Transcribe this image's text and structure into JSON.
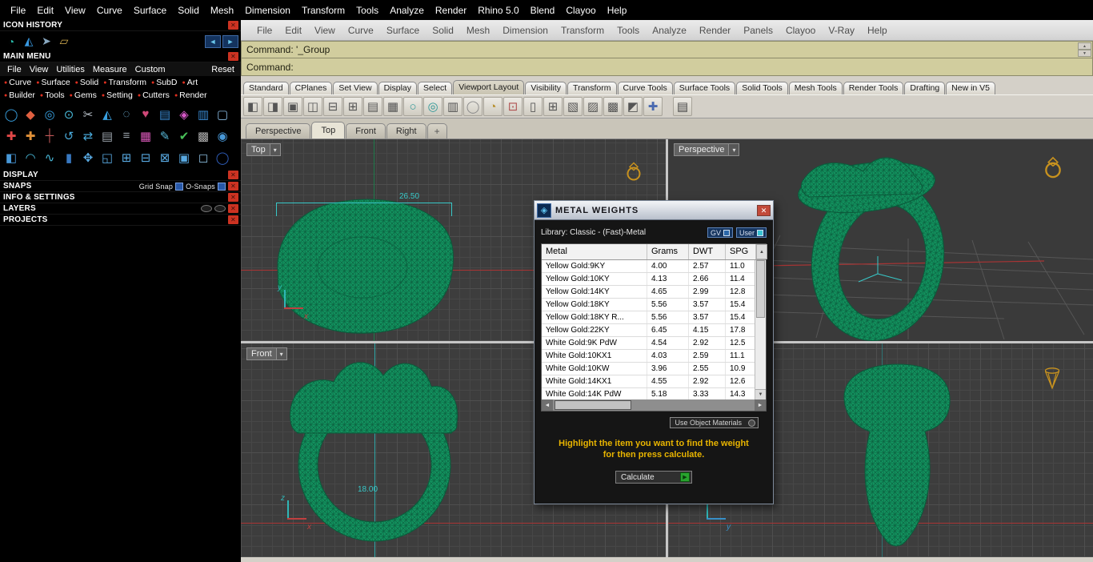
{
  "icons": {
    "close": "✕",
    "dropdown": "▾",
    "up": "▲",
    "down": "▼",
    "left": "◄",
    "right": "►",
    "play": "▶",
    "plus_tab": "+",
    "bullet": "●"
  },
  "colors": {
    "viewport_green": "#12925e",
    "dimension_teal": "#38c8c8",
    "axis_red": "#a83434",
    "gold": "#c8921e"
  },
  "top_menubar": {
    "items": [
      "File",
      "Edit",
      "View",
      "Curve",
      "Surface",
      "Solid",
      "Mesh",
      "Dimension",
      "Transform",
      "Tools",
      "Analyze",
      "Render",
      "Rhino 5.0",
      "Blend",
      "Clayoo",
      "Help"
    ]
  },
  "menubar2": {
    "items": [
      "File",
      "Edit",
      "View",
      "Curve",
      "Surface",
      "Solid",
      "Mesh",
      "Dimension",
      "Transform",
      "Tools",
      "Analyze",
      "Render",
      "Panels",
      "Clayoo",
      "V-Ray",
      "Help"
    ]
  },
  "sidebar": {
    "icon_history": {
      "title": "ICON HISTORY",
      "icons": [
        {
          "g": "◔",
          "c": "#28b8a8"
        },
        {
          "g": "◭",
          "c": "#3898e0"
        },
        {
          "g": "➤",
          "c": "#88a8c0"
        },
        {
          "g": "▱",
          "c": "#d8b050"
        }
      ]
    },
    "main_menu": {
      "title": "MAIN MENU",
      "items": [
        "File",
        "View",
        "Utilities",
        "Measure",
        "Custom"
      ],
      "reset": "Reset",
      "cats1": [
        "Curve",
        "Surface",
        "Solid",
        "Transform",
        "SubD",
        "Art"
      ],
      "cats2": [
        "Builder",
        "Tools",
        "Gems",
        "Setting",
        "Cutters",
        "Render"
      ],
      "icon_rows": [
        [
          {
            "g": "◯",
            "c": "#38a0e0"
          },
          {
            "g": "◆",
            "c": "#e06040"
          },
          {
            "g": "◎",
            "c": "#38a0e0"
          },
          {
            "g": "⊙",
            "c": "#48b8d8"
          },
          {
            "g": "✂",
            "c": "#b8c0c8"
          },
          {
            "g": "◭",
            "c": "#38a0e0"
          },
          {
            "g": "◌",
            "c": "#78c0e8"
          },
          {
            "g": "♥",
            "c": "#d04878"
          },
          {
            "g": "▤",
            "c": "#3888d0"
          },
          {
            "g": "◈",
            "c": "#d858c8"
          },
          {
            "g": "▥",
            "c": "#3888d0"
          },
          {
            "g": "▢",
            "c": "#88b8e0"
          }
        ],
        [
          {
            "g": "✚",
            "c": "#e04848"
          },
          {
            "g": "✚",
            "c": "#e09038"
          },
          {
            "g": "┼",
            "c": "#c05858"
          },
          {
            "g": "↺",
            "c": "#48a8d8"
          },
          {
            "g": "⇄",
            "c": "#48a8d8"
          },
          {
            "g": "▤",
            "c": "#98a0a8"
          },
          {
            "g": "≡",
            "c": "#98a0a8"
          },
          {
            "g": "▦",
            "c": "#d858b8"
          },
          {
            "g": "✎",
            "c": "#58b8d8"
          },
          {
            "g": "✔",
            "c": "#48c058"
          },
          {
            "g": "▩",
            "c": "#b0b0b0"
          },
          {
            "g": "◉",
            "c": "#4898d8"
          }
        ],
        [
          {
            "g": "◧",
            "c": "#4898d8"
          },
          {
            "g": "◠",
            "c": "#48b8d8"
          },
          {
            "g": "∿",
            "c": "#48b8d8"
          },
          {
            "g": "▮",
            "c": "#3878c0"
          },
          {
            "g": "✥",
            "c": "#58a8e0"
          },
          {
            "g": "◱",
            "c": "#58a8e0"
          },
          {
            "g": "⊞",
            "c": "#58a8e0"
          },
          {
            "g": "⊟",
            "c": "#58a8e0"
          },
          {
            "g": "⊠",
            "c": "#58a8e0"
          },
          {
            "g": "▣",
            "c": "#58a8e0"
          },
          {
            "g": "◻",
            "c": "#88b8d8"
          },
          {
            "g": "◯",
            "c": "#3060c0"
          }
        ]
      ]
    },
    "display": {
      "title": "DISPLAY"
    },
    "snaps": {
      "title": "SNAPS",
      "grid_snap": "Grid Snap",
      "osnaps": "O-Snaps"
    },
    "info": {
      "title": "INFO & SETTINGS"
    },
    "layers": {
      "title": "LAYERS"
    },
    "projects": {
      "title": "PROJECTS"
    }
  },
  "command": {
    "history": "Command: '_Group",
    "prompt": "Command:"
  },
  "ribbon_tabs": {
    "items": [
      "Standard",
      "CPlanes",
      "Set View",
      "Display",
      "Select",
      "Viewport Layout",
      "Visibility",
      "Transform",
      "Curve Tools",
      "Surface Tools",
      "Solid Tools",
      "Mesh Tools",
      "Render Tools",
      "Drafting",
      "New in V5"
    ],
    "active": "Viewport Layout"
  },
  "toolbar_icons": [
    {
      "g": "◧"
    },
    {
      "g": "◨"
    },
    {
      "g": "▣"
    },
    {
      "g": "◫"
    },
    {
      "g": "⊟"
    },
    {
      "g": "⊞"
    },
    {
      "g": "▤"
    },
    {
      "g": "▦"
    },
    {
      "g": "○",
      "c": "#2f9898"
    },
    {
      "g": "◎",
      "c": "#2f9898"
    },
    {
      "g": "▥"
    },
    {
      "g": "◯",
      "c": "#888888"
    },
    {
      "g": "◔",
      "c": "#b89030"
    },
    {
      "g": "⊡",
      "c": "#b05050"
    },
    {
      "g": "▯"
    },
    {
      "g": "⊞"
    },
    {
      "g": "▧"
    },
    {
      "g": "▨"
    },
    {
      "g": "▩"
    },
    {
      "g": "◩"
    },
    {
      "g": "✚",
      "c": "#4a6ab0"
    },
    {
      "g": "▤",
      "c": "#444444",
      "sep": true,
      "n": "printer"
    }
  ],
  "viewport_tabs": {
    "items": [
      "Perspective",
      "Top",
      "Front",
      "Right"
    ],
    "active": "Top"
  },
  "viewports": {
    "top": {
      "label": "Top",
      "dimension": "26.50",
      "axis_v": "y",
      "axis_h": "x"
    },
    "perspective": {
      "label": "Perspective"
    },
    "front": {
      "label": "Front",
      "dimension": "18.00",
      "axis_v": "z",
      "axis_h": "x"
    },
    "right": {
      "axis_v": "z",
      "axis_h": "y"
    }
  },
  "dialog": {
    "title": "METAL WEIGHTS",
    "library": "Library: Classic - (Fast)-Metal",
    "gv": "GV",
    "user": "User",
    "table": {
      "headers": [
        "Metal",
        "Grams",
        "DWT",
        "SPG"
      ],
      "rows": [
        [
          "Yellow Gold:9KY",
          "4.00",
          "2.57",
          "11.0"
        ],
        [
          "Yellow Gold:10KY",
          "4.13",
          "2.66",
          "11.4"
        ],
        [
          "Yellow Gold:14KY",
          "4.65",
          "2.99",
          "12.8"
        ],
        [
          "Yellow Gold:18KY",
          "5.56",
          "3.57",
          "15.4"
        ],
        [
          "Yellow Gold:18KY R...",
          "5.56",
          "3.57",
          "15.4"
        ],
        [
          "Yellow Gold:22KY",
          "6.45",
          "4.15",
          "17.8"
        ],
        [
          "White Gold:9K PdW",
          "4.54",
          "2.92",
          "12.5"
        ],
        [
          "White Gold:10KX1",
          "4.03",
          "2.59",
          "11.1"
        ],
        [
          "White Gold:10KW",
          "3.96",
          "2.55",
          "10.9"
        ],
        [
          "White Gold:14KX1",
          "4.55",
          "2.92",
          "12.6"
        ],
        [
          "White Gold:14K PdW",
          "5.18",
          "3.33",
          "14.3"
        ]
      ]
    },
    "materials_select": "Use Object Materials",
    "instruction_line1": "Highlight the item you want to find the weight",
    "instruction_line2": "for then press calculate.",
    "calculate": "Calculate"
  }
}
